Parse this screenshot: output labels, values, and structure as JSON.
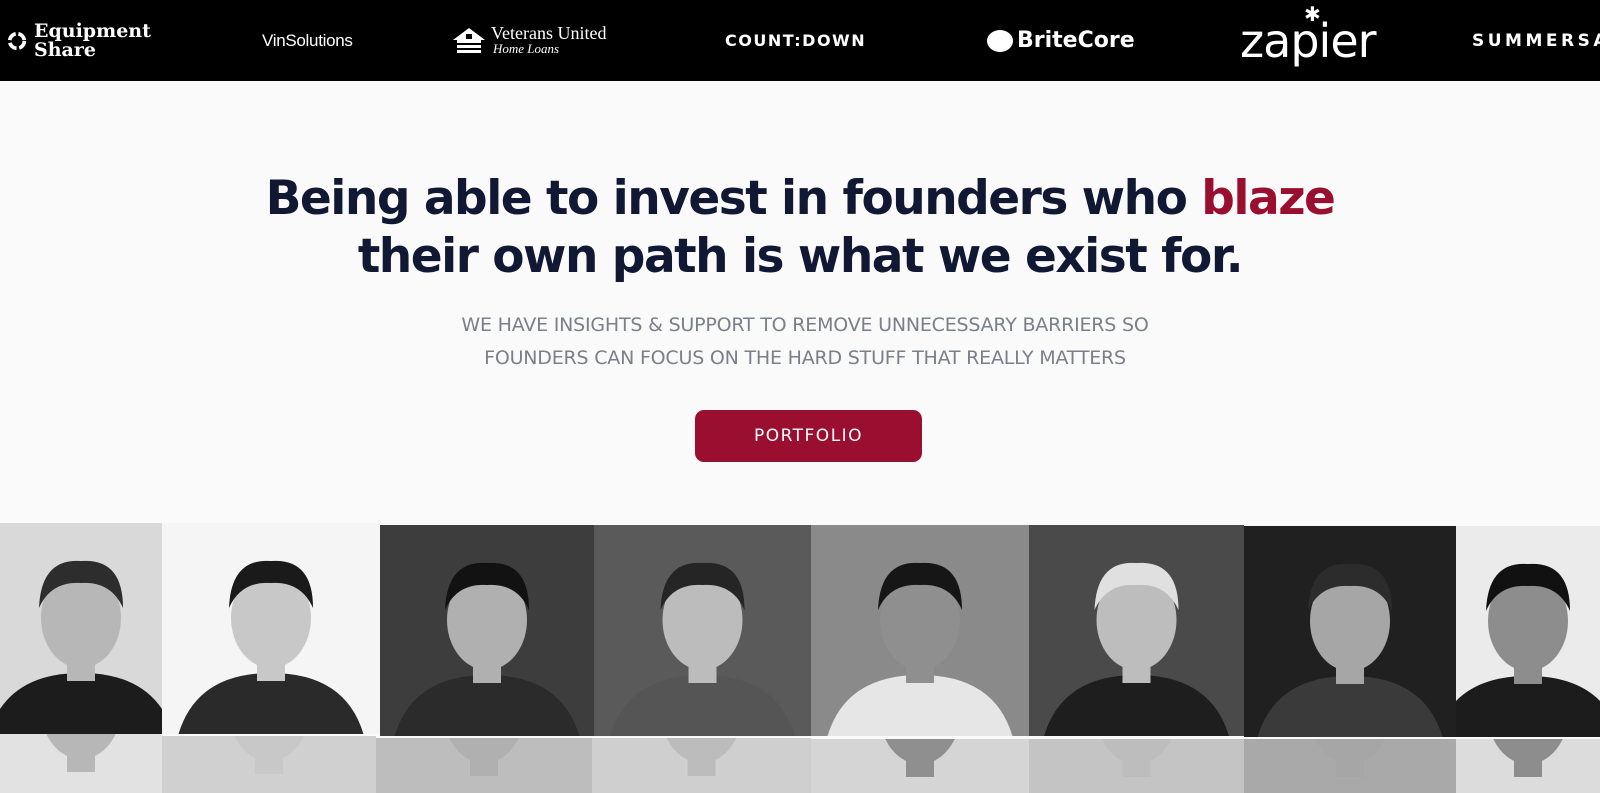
{
  "logos": {
    "equipment_share": [
      "Equipment",
      "Share"
    ],
    "vinsolutions": "VinSolutions",
    "veterans_united": {
      "name": "Veterans United",
      "sub": "Home Loans"
    },
    "countdown": "COUNT:DOWN",
    "britecore": "BriteCore",
    "zapier": "zapier",
    "summersalt": "SUMMERSA"
  },
  "hero": {
    "headline_part1": "Being able to invest in founders who ",
    "headline_accent": "blaze",
    "headline_part2": "their own path is what we exist for.",
    "subtext_line1": "WE HAVE INSIGHTS & SUPPORT TO REMOVE UNNECESSARY BARRIERS SO",
    "subtext_line2": "FOUNDERS CAN FOCUS ON THE HARD STUFF THAT REALLY MATTERS",
    "cta_label": "PORTFOLIO"
  },
  "colors": {
    "brand": "#9a0e30",
    "headline": "#111833",
    "subtext": "#7a7f8a",
    "strip_bg": "#000000"
  },
  "grid": {
    "tiles": [
      {
        "name": "founder-photo-1",
        "bg": "#d9d9d9",
        "shirt": "#1c1c1c",
        "hair": "#2d2d2d",
        "skin": "#b7b7b7"
      },
      {
        "name": "founder-photo-2",
        "bg": "#f5f5f5",
        "shirt": "#2a2a2a",
        "hair": "#1a1a1a",
        "skin": "#c8c8c8"
      },
      {
        "name": "founder-photo-3",
        "bg": "#3d3d3d",
        "shirt": "#2b2b2b",
        "hair": "#121212",
        "skin": "#b0b0b0"
      },
      {
        "name": "founder-photo-4",
        "bg": "#5a5a5a",
        "shirt": "#555555",
        "hair": "#252525",
        "skin": "#bcbcbc"
      },
      {
        "name": "founder-photo-5",
        "bg": "#8a8a8a",
        "shirt": "#e6e6e6",
        "hair": "#161616",
        "skin": "#8f8f8f"
      },
      {
        "name": "founder-photo-6",
        "bg": "#4a4a4a",
        "shirt": "#1e1e1e",
        "hair": "#e0e0e0",
        "skin": "#bdbdbd"
      },
      {
        "name": "founder-photo-7",
        "bg": "#202020",
        "shirt": "#3a3a3a",
        "hair": "#2c2c2c",
        "skin": "#a6a6a6"
      },
      {
        "name": "founder-photo-8",
        "bg": "#ebebeb",
        "shirt": "#1c1c1c",
        "hair": "#111111",
        "skin": "#8d8d8d"
      }
    ],
    "bottom_row": [
      {
        "name": "founder-photo-9",
        "bg": "#e2e2e2"
      },
      {
        "name": "founder-photo-10",
        "bg": "#d0d0d0"
      },
      {
        "name": "founder-photo-11",
        "bg": "#bdbdbd"
      },
      {
        "name": "founder-photo-12",
        "bg": "#cfcfcf"
      },
      {
        "name": "founder-photo-13",
        "bg": "#d5d5d5"
      },
      {
        "name": "founder-photo-14",
        "bg": "#c4c4c4"
      },
      {
        "name": "founder-photo-15",
        "bg": "#a9a9a9"
      },
      {
        "name": "founder-photo-16",
        "bg": "#dcdcdc"
      }
    ]
  }
}
